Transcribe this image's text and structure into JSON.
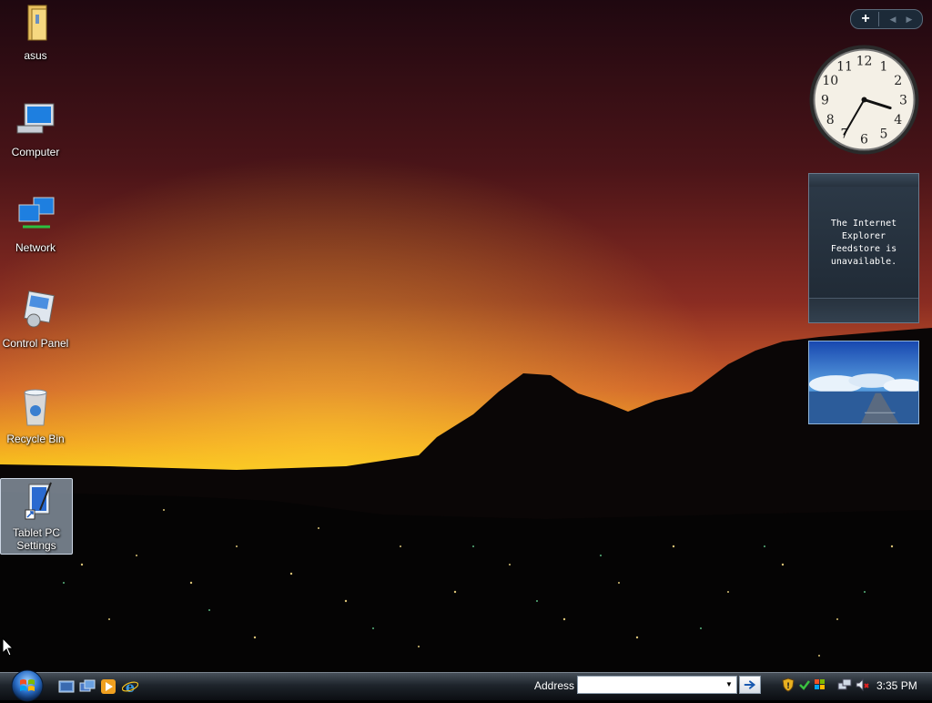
{
  "desktop": {
    "icons": [
      {
        "label": "asus",
        "icon": "user-folder-icon"
      },
      {
        "label": "Computer",
        "icon": "computer-icon"
      },
      {
        "label": "Network",
        "icon": "network-icon"
      },
      {
        "label": "Control Panel",
        "icon": "control-panel-icon"
      },
      {
        "label": "Recycle Bin",
        "icon": "recycle-bin-icon"
      },
      {
        "label_line1": "Tablet PC",
        "label_line2": "Settings",
        "icon": "tablet-pc-settings-icon",
        "selected": true
      }
    ]
  },
  "sidebar": {
    "add_gadget_symbol": "+",
    "prev_symbol": "◀",
    "next_symbol": "▶",
    "clock": {
      "numbers": [
        "12",
        "1",
        "2",
        "3",
        "4",
        "5",
        "6",
        "7",
        "8",
        "9",
        "10",
        "11"
      ],
      "hour": 3,
      "minute": 35
    },
    "feed": {
      "message_line1": "The Internet Explorer",
      "message_line2": "Feedstore is",
      "message_line3": "unavailable."
    }
  },
  "taskbar": {
    "address_label": "Address",
    "address_value": "",
    "time": "3:35 PM",
    "quick_launch": [
      "show-desktop-icon",
      "switch-windows-icon",
      "media-player-icon",
      "internet-explorer-icon"
    ],
    "tray_icons": [
      "security-shield-icon",
      "network-sync-icon",
      "windows-update-icon",
      "network-connection-icon",
      "volume-muted-icon"
    ]
  },
  "colors": {
    "sky_top": "#2a0a12",
    "sky_mid": "#b0402a",
    "horizon": "#f2b21c",
    "taskbar": "#1e242b"
  }
}
